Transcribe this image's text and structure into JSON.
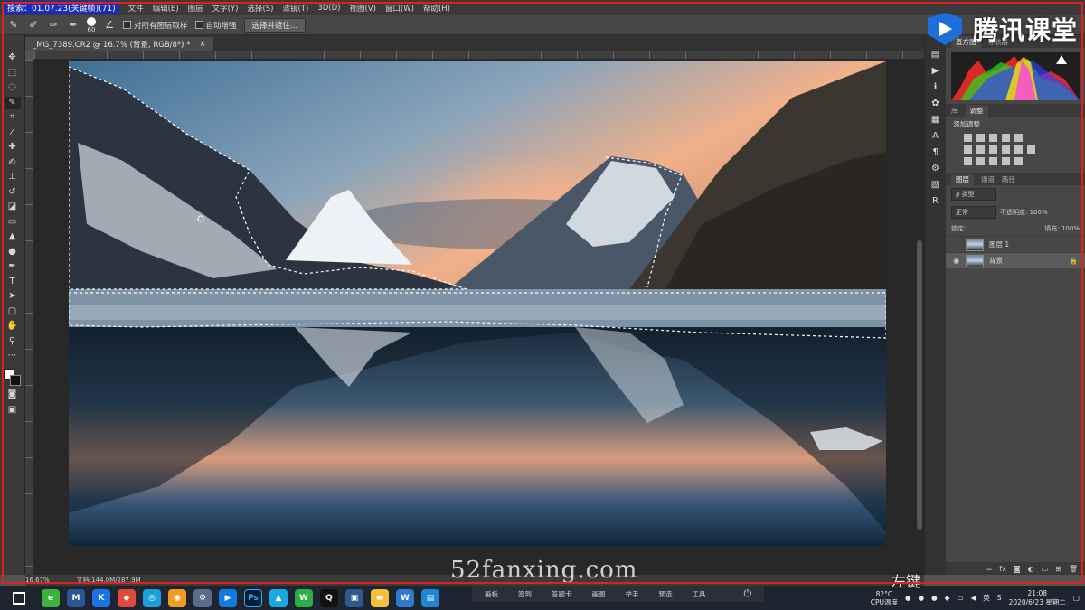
{
  "menubar": {
    "search_banner": "搜索：01.07.23(关键帧)(71)",
    "items": [
      "文件",
      "编辑(E)",
      "图层",
      "文字(Y)",
      "选择(S)",
      "滤镜(T)",
      "3D(D)",
      "视图(V)",
      "窗口(W)",
      "帮助(H)"
    ]
  },
  "options": {
    "brush_size": "60",
    "sample_all_layers": "对所有图层取样",
    "auto_enhance": "自动增强",
    "select_and_mask": "选择并遮住..."
  },
  "logo": {
    "text": "腾讯课堂"
  },
  "document": {
    "tab_title": "_MG_7389.CR2 @ 16.7% (背景, RGB/8*) *",
    "close": "×"
  },
  "status": {
    "zoom": "16.67%",
    "doc_size": "文档:144.0M/287.9M"
  },
  "panels": {
    "histogram_tabs": [
      "直方图",
      "导航器"
    ],
    "adjust_tabs": [
      "库",
      "调整"
    ],
    "adjust_title": "添加调整",
    "layers_tabs": [
      "图层",
      "通道",
      "路径"
    ],
    "kind_filter": "ρ 类型",
    "blend_mode": "正常",
    "opacity_label": "不透明度: 100%",
    "lock_label": "锁定:",
    "fill_label": "填充: 100%",
    "layers": [
      {
        "name": "图层 1",
        "visible": false,
        "selected": false
      },
      {
        "name": "背景",
        "visible": true,
        "selected": true
      }
    ]
  },
  "recorder": {
    "tools": [
      "画板",
      "签到",
      "答题卡",
      "画图",
      "举手",
      "预选",
      "工具"
    ]
  },
  "tray": {
    "temp": "82°C",
    "temp_label": "CPU温度",
    "ime": "英",
    "time": "21:08",
    "date": "2020/6/23 星期二"
  },
  "overlay": {
    "key_hint": "左键",
    "site_watermark": "52fanxing.com"
  },
  "colors": {
    "accent_red": "#e02020",
    "ps_blue": "#31a8ff"
  }
}
